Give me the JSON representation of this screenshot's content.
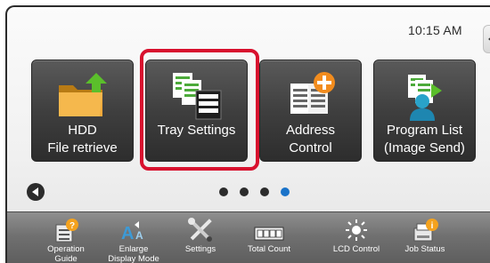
{
  "status": {
    "time": "10:15 AM"
  },
  "tiles": [
    {
      "label": "HDD\nFile retrieve",
      "icon": "hdd-folder-icon"
    },
    {
      "label": "Tray Settings",
      "icon": "tray-settings-icon"
    },
    {
      "label": "Address\nControl",
      "icon": "address-control-icon"
    },
    {
      "label": "Program List\n(Image Send)",
      "icon": "program-list-icon"
    }
  ],
  "pagination": {
    "pages": 4,
    "current": 4
  },
  "bottom_bar": [
    {
      "label": "Operation\nGuide",
      "icon": "operation-guide-icon"
    },
    {
      "label": "Enlarge\nDisplay Mode",
      "icon": "enlarge-display-icon"
    },
    {
      "label": "Settings",
      "icon": "settings-tools-icon"
    },
    {
      "label": "Total Count",
      "icon": "total-count-icon"
    },
    {
      "label": "LCD Control",
      "icon": "lcd-control-icon"
    },
    {
      "label": "Job Status",
      "icon": "job-status-icon"
    }
  ],
  "colors": {
    "highlight": "#d8112e",
    "active_dot": "#1a73c9",
    "tile_bg": "#3f3f3f"
  }
}
